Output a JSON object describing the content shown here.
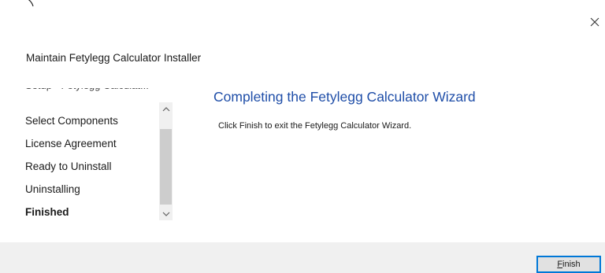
{
  "window": {
    "title": "Maintain Fetylegg Calculator Installer",
    "close_icon": "close-icon"
  },
  "steps": {
    "items": [
      {
        "label": "Setup - Fetylegg Calculat...",
        "state": "partially-visible"
      },
      {
        "label": "Select Components",
        "state": "normal"
      },
      {
        "label": "License Agreement",
        "state": "normal"
      },
      {
        "label": "Ready to Uninstall",
        "state": "normal"
      },
      {
        "label": "Uninstalling",
        "state": "normal"
      },
      {
        "label": "Finished",
        "state": "current"
      }
    ],
    "scrollbar": {
      "up_icon": "chevron-up-icon",
      "down_icon": "chevron-down-icon"
    }
  },
  "main": {
    "heading": "Completing the Fetylegg Calculator Wizard",
    "message": "Click Finish to exit the Fetylegg Calculator Wizard."
  },
  "footer": {
    "finish_accel": "F",
    "finish_rest": "inish"
  },
  "colors": {
    "heading": "#1f4ea8",
    "footer_bg": "#f0f0f0",
    "button_border": "#0078d7"
  }
}
